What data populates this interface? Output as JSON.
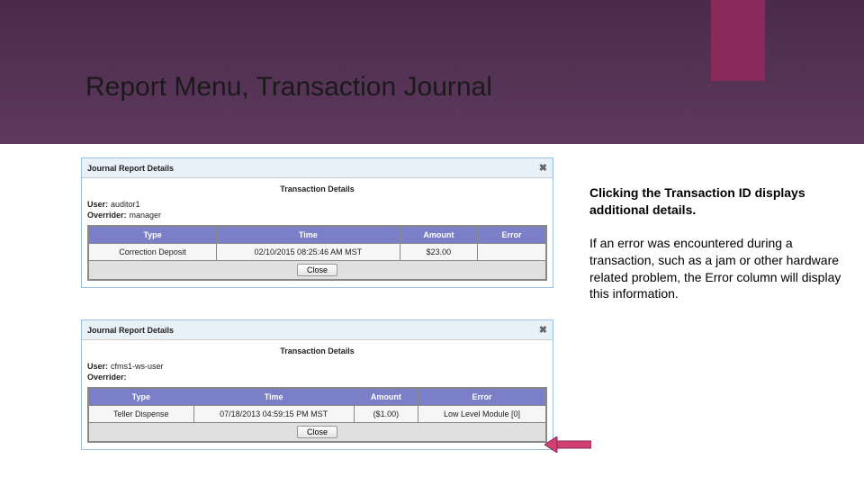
{
  "slide": {
    "title": "Report Menu, Transaction Journal"
  },
  "sideText": {
    "p1_a": "Clicking the ",
    "p1_b": "Transaction ID",
    "p1_c": " displays additional details.",
    "p2_a": "If an error was encountered during a transaction, such as a jam or other hardware related problem, the ",
    "p2_b": "Error",
    "p2_c": " column will display this information."
  },
  "dialog1": {
    "header": "Journal Report Details",
    "subtitle": "Transaction Details",
    "userLabel": "User:",
    "userValue": "auditor1",
    "overriderLabel": "Overrider:",
    "overriderValue": "manager",
    "headers": [
      "Type",
      "Time",
      "Amount",
      "Error"
    ],
    "row": [
      "Correction Deposit",
      "02/10/2015 08:25:46 AM MST",
      "$23.00",
      ""
    ],
    "closeBtn": "Close"
  },
  "dialog2": {
    "header": "Journal Report Details",
    "subtitle": "Transaction Details",
    "userLabel": "User:",
    "userValue": "cfms1-ws-user",
    "overriderLabel": "Overrider:",
    "overriderValue": "",
    "headers": [
      "Type",
      "Time",
      "Amount",
      "Error"
    ],
    "row": [
      "Teller Dispense",
      "07/18/2013 04:59:15 PM MST",
      "($1.00)",
      "Low Level Module [0]"
    ],
    "closeBtn": "Close"
  }
}
